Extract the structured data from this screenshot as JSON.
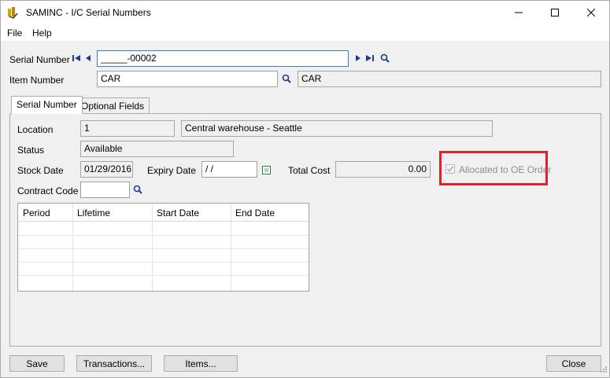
{
  "window": {
    "title": "SAMINC - I/C Serial Numbers",
    "icons": {
      "app": "sage-app-icon",
      "minimize": "minimize-icon",
      "maximize": "maximize-icon",
      "close": "close-icon"
    }
  },
  "menu": {
    "file": "File",
    "help": "Help"
  },
  "header": {
    "serial_label": "Serial Number",
    "serial_value": "_____-00002",
    "item_label": "Item Number",
    "item_value": "CAR",
    "item_desc": "CAR"
  },
  "tabs": [
    {
      "label": "Serial Number",
      "active": true
    },
    {
      "label": "Optional Fields",
      "active": false
    }
  ],
  "form": {
    "location_label": "Location",
    "location_code": "1",
    "location_desc": "Central warehouse - Seattle",
    "status_label": "Status",
    "status_value": "Available",
    "stock_date_label": "Stock Date",
    "stock_date_value": "01/29/2016",
    "expiry_date_label": "Expiry Date",
    "expiry_date_value": " / /",
    "total_cost_label": "Total Cost",
    "total_cost_value": "0.00",
    "allocated_label": "Allocated to OE Order",
    "allocated_checked": true,
    "contract_code_label": "Contract Code",
    "contract_code_value": ""
  },
  "grid": {
    "columns": [
      "Period",
      "Lifetime",
      "Start Date",
      "End Date"
    ],
    "rows": []
  },
  "buttons": {
    "save": "Save",
    "transactions": "Transactions...",
    "items": "Items...",
    "close": "Close"
  },
  "colors": {
    "highlight": "#e0202a",
    "focus": "#3c7fb1",
    "nav_icons": "#1f3c8c"
  }
}
